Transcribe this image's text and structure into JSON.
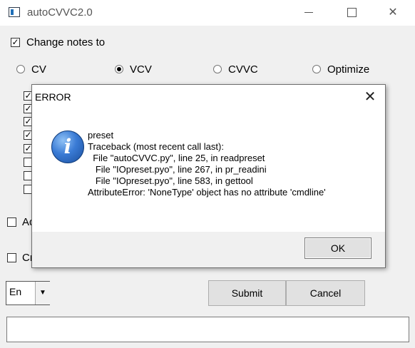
{
  "window": {
    "title": "autoCVVC2.0",
    "controls": {
      "minimize": "",
      "maximize": "",
      "close": "✕"
    }
  },
  "options": {
    "change_notes_label": "Change notes to",
    "change_notes_checked": true,
    "modes": [
      {
        "label": "CV",
        "selected": false
      },
      {
        "label": "VCV",
        "selected": true
      },
      {
        "label": "CVVC",
        "selected": false
      },
      {
        "label": "Optimize",
        "selected": false
      }
    ],
    "list_checkboxes": [
      "✓",
      "✓",
      "✓",
      "✓",
      "✓",
      "",
      "",
      ""
    ],
    "partial_label_1": "Ad",
    "partial_label_2": "Cr"
  },
  "footer": {
    "language_value": "En",
    "dropdown_glyph": "▼",
    "submit_label": "Submit",
    "cancel_label": "Cancel",
    "command_value": ""
  },
  "dialog": {
    "title": "ERROR",
    "close_glyph": "✕",
    "icon_glyph": "i",
    "message_lines": [
      "preset",
      "Traceback (most recent call last):",
      "  File \"autoCVVC.py\", line 25, in readpreset",
      "   File \"IOpreset.pyo\", line 267, in pr_readini",
      "   File \"IOpreset.pyo\", line 583, in gettool",
      "AttributeError: 'NoneType' object has no attribute 'cmdline'"
    ],
    "ok_label": "OK"
  }
}
